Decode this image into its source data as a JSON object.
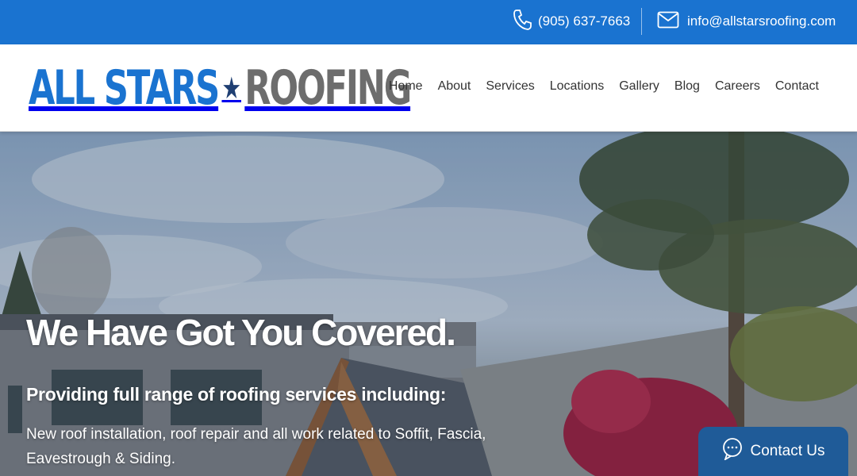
{
  "topbar": {
    "phone": "(905) 637-7663",
    "email": "info@allstarsroofing.com",
    "phone_icon": "phone-icon",
    "email_icon": "mail-icon",
    "background_color": "#1a73d0"
  },
  "logo": {
    "part1": "ALL STARS",
    "star": "★",
    "part2": "ROOFING",
    "colors": {
      "primary": "#1a73d0",
      "star": "#1f3f73",
      "secondary": "#6d6d6d"
    }
  },
  "nav": {
    "items": [
      {
        "label": "Home"
      },
      {
        "label": "About"
      },
      {
        "label": "Services"
      },
      {
        "label": "Locations"
      },
      {
        "label": "Gallery"
      },
      {
        "label": "Blog"
      },
      {
        "label": "Careers"
      },
      {
        "label": "Contact"
      }
    ]
  },
  "hero": {
    "heading": "We Have Got You Covered.",
    "subheading": "Providing full range of roofing services including:",
    "description": "New roof installation, roof repair and all work related to Soffit, Fascia, Eavestrough & Siding."
  },
  "contact_widget": {
    "label": "Contact Us",
    "icon": "chat-bubble-icon",
    "background_color": "#1f5b98"
  }
}
